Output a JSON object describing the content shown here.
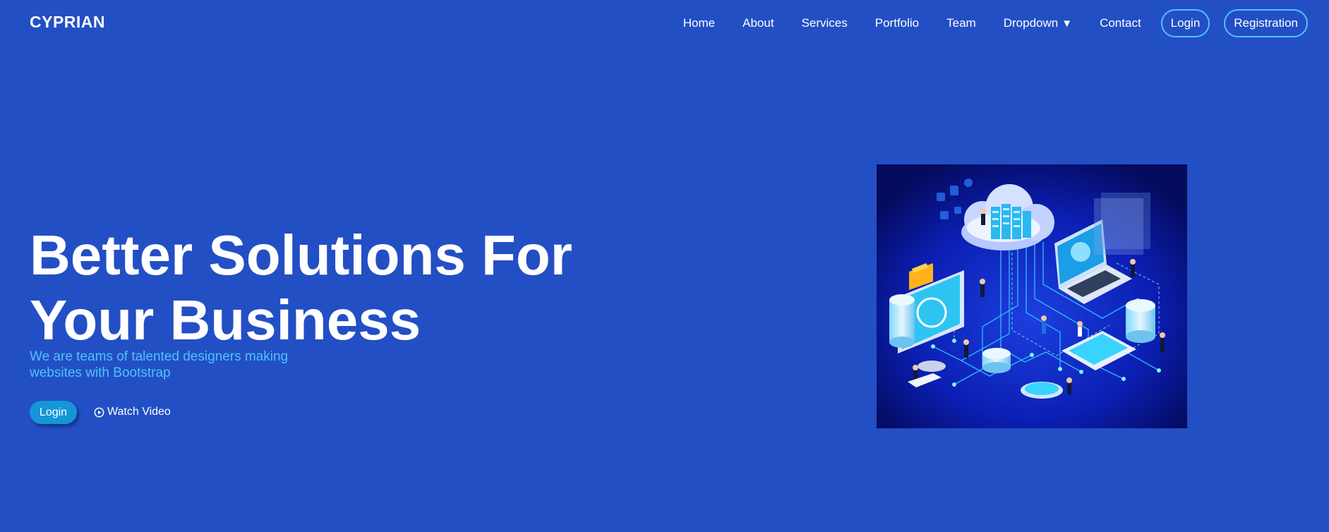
{
  "brand": "CYPRIAN",
  "nav": {
    "home": "Home",
    "about": "About",
    "services": "Services",
    "portfolio": "Portfolio",
    "team": "Team",
    "dropdown": "Dropdown",
    "dropdown_caret": "▼",
    "contact": "Contact",
    "login": "Login",
    "registration": "Registration"
  },
  "hero": {
    "title_line1": "Better Solutions For",
    "title_line2": "Your Business",
    "subtitle": "We are teams of talented designers making websites with Bootstrap",
    "login_button": "Login",
    "watch_video": "Watch Video"
  },
  "illustration": {
    "icon": "isometric-cloud-network-illustration"
  },
  "colors": {
    "background": "#234fc5",
    "accent": "#4fc3f7",
    "button": "#1496d9"
  }
}
